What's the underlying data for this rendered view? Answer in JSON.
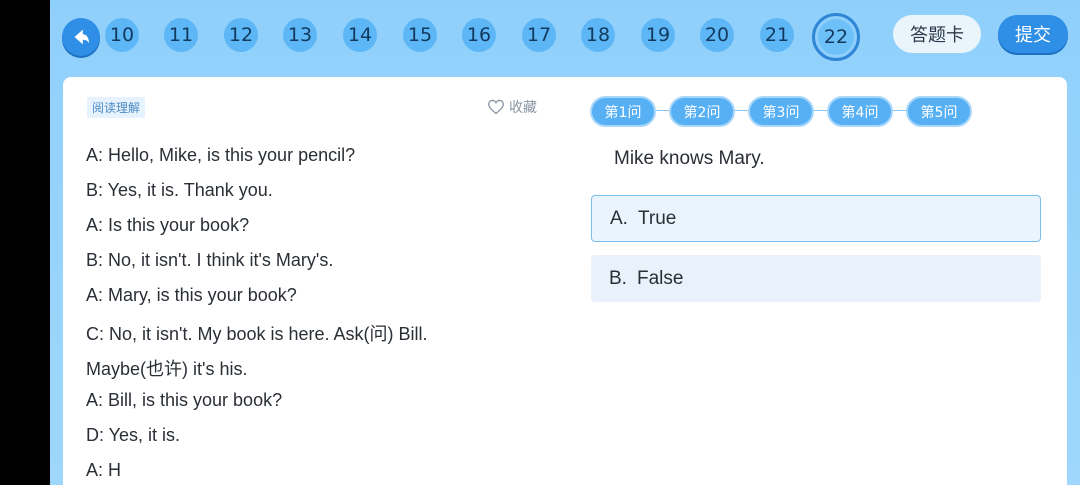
{
  "nav": {
    "question_numbers": [
      "10",
      "11",
      "12",
      "13",
      "14",
      "15",
      "16",
      "17",
      "18",
      "19",
      "20",
      "21",
      "22"
    ],
    "current": "22",
    "answer_card_label": "答题卡",
    "submit_label": "提交"
  },
  "passage": {
    "tag": "阅读理解",
    "favorite_label": "收藏",
    "lines": [
      "A: Hello, Mike, is this your pencil?",
      "B: Yes, it is. Thank you.",
      "A: Is this your book?",
      "B: No, it isn't. I think it's Mary's.",
      "A: Mary, is this your book?",
      "C: No, it isn't. My book is here. Ask(问) Bill.",
      "Maybe(也许) it's his.",
      "A: Bill, is this your book?",
      "D: Yes, it is.",
      "A: H"
    ]
  },
  "question": {
    "steps": [
      "第1问",
      "第2问",
      "第3问",
      "第4问",
      "第5问"
    ],
    "text": "Mike knows Mary.",
    "options": [
      {
        "letter": "A.",
        "text": "True"
      },
      {
        "letter": "B.",
        "text": "False"
      }
    ]
  }
}
